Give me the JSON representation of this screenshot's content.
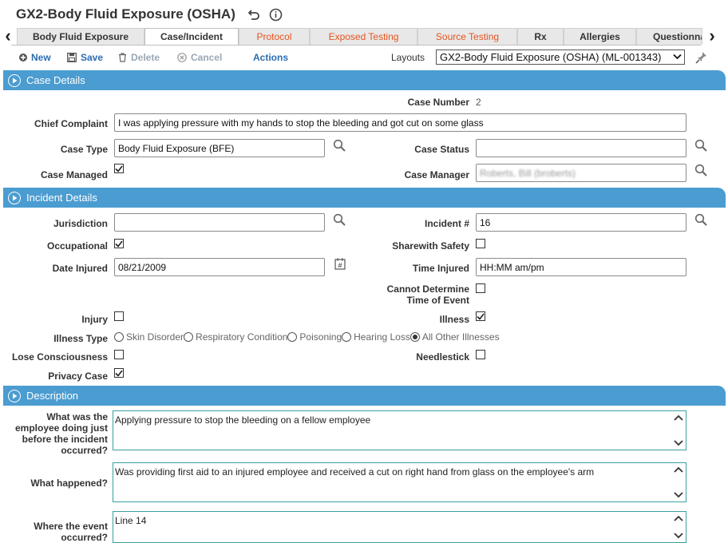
{
  "header": {
    "title": "GX2-Body Fluid Exposure (OSHA)"
  },
  "tabs": [
    {
      "label": "Body Fluid Exposure",
      "state": "normal"
    },
    {
      "label": "Case/Incident",
      "state": "active"
    },
    {
      "label": "Protocol",
      "state": "orange"
    },
    {
      "label": "Exposed Testing",
      "state": "orange"
    },
    {
      "label": "Source Testing",
      "state": "orange"
    },
    {
      "label": "Rx",
      "state": "normal"
    },
    {
      "label": "Allergies",
      "state": "normal"
    },
    {
      "label": "Questionna",
      "state": "normal"
    }
  ],
  "toolbar": {
    "new_label": "New",
    "save_label": "Save",
    "delete_label": "Delete",
    "cancel_label": "Cancel",
    "actions_label": "Actions",
    "layouts_label": "Layouts",
    "layouts_value": "GX2-Body Fluid Exposure (OSHA) (ML-001343)"
  },
  "sections": {
    "case_details": "Case Details",
    "incident_details": "Incident Details",
    "description": "Description"
  },
  "case": {
    "case_number_label": "Case Number",
    "case_number": "2",
    "chief_complaint_label": "Chief Complaint",
    "chief_complaint": "I was applying pressure with my hands to stop the bleeding and got cut on some glass",
    "case_type_label": "Case Type",
    "case_type": "Body Fluid Exposure (BFE)",
    "case_status_label": "Case Status",
    "case_status": "",
    "case_managed_label": "Case Managed",
    "case_managed": true,
    "case_manager_label": "Case Manager",
    "case_manager": "Roberts, Bill (broberts)"
  },
  "incident": {
    "jurisdiction_label": "Jurisdiction",
    "jurisdiction": "",
    "incident_no_label": "Incident #",
    "incident_no": "16",
    "occupational_label": "Occupational",
    "occupational": true,
    "sharewith_label": "Sharewith Safety",
    "sharewith": false,
    "date_injured_label": "Date Injured",
    "date_injured": "08/21/2009",
    "time_injured_label": "Time Injured",
    "time_injured": "HH:MM am/pm",
    "cannot_determine_label": "Cannot Determine Time of Event",
    "cannot_determine": false,
    "injury_label": "Injury",
    "injury": false,
    "illness_label": "Illness",
    "illness": true,
    "illness_type_label": "Illness Type",
    "illness_types": [
      "Skin Disorder",
      "Respiratory Condition",
      "Poisoning",
      "Hearing Loss",
      "All Other Illnesses"
    ],
    "illness_type_selected": "All Other Illnesses",
    "lose_consciousness_label": "Lose Consciousness",
    "lose_consciousness": false,
    "needlestick_label": "Needlestick",
    "needlestick": false,
    "privacy_label": "Privacy Case",
    "privacy": true
  },
  "description": {
    "q1_label": "What was the employee doing just before the incident occurred?",
    "q1_value": "Applying pressure to stop the bleeding on a fellow employee",
    "q2_label": "What happened?",
    "q2_value": "Was providing first aid to an injured employee and received a cut on right hand from glass on the employee's arm",
    "q3_label": "Where the event occurred?",
    "q3_value": "Line 14"
  },
  "colors": {
    "section_bar": "#4b9cd0",
    "link_blue": "#2b6cb0",
    "tab_orange": "#e8531e",
    "textarea_border": "#3a9f9f"
  },
  "icons": [
    "undo-icon",
    "info-icon",
    "chevron-left-icon",
    "chevron-right-icon",
    "plus-icon",
    "save-icon",
    "trash-icon",
    "cancel-icon",
    "search-icon",
    "calendar-icon",
    "pin-icon",
    "play-circle-icon"
  ]
}
